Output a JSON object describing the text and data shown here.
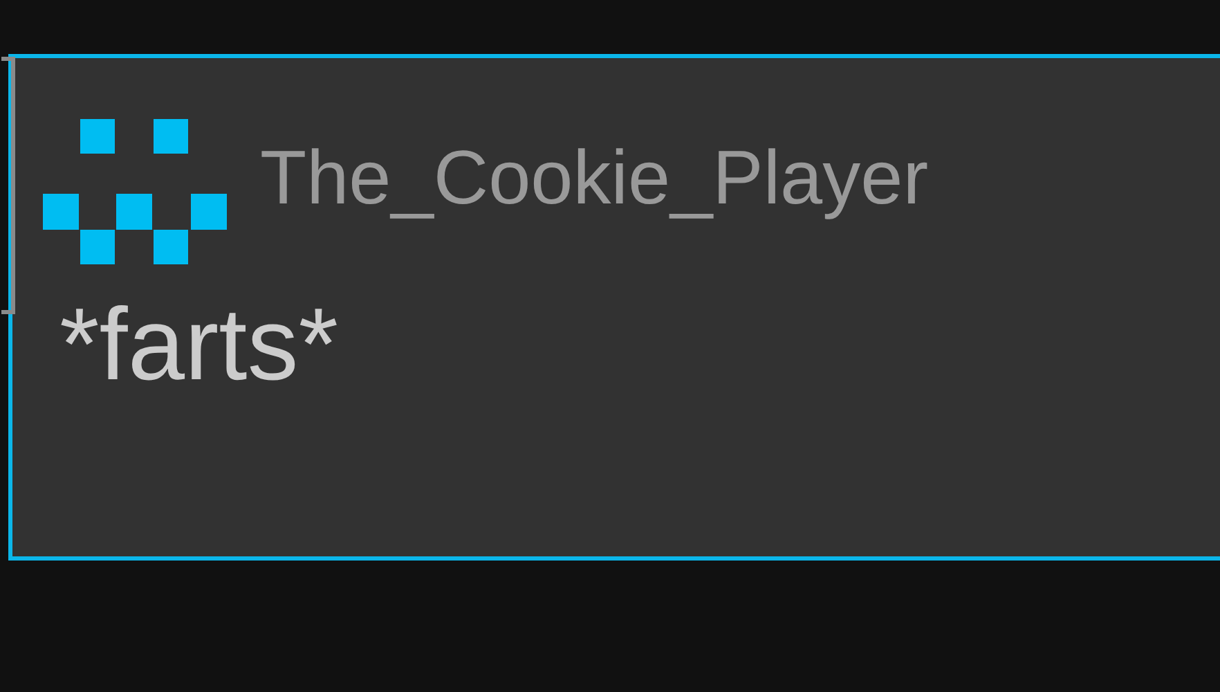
{
  "message": {
    "username": "The_Cookie_Player",
    "text": "*farts*"
  }
}
